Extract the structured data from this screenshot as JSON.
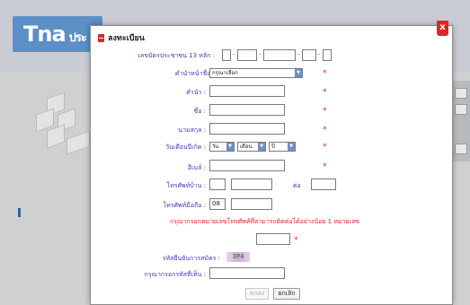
{
  "background": {
    "logo": "Tna",
    "logo_suffix": "ประ"
  },
  "modal": {
    "title": "ลงทะเบียน",
    "close_label": "x",
    "fields": {
      "id_label": "เลขบัตรประชาชน 13 หลัก :",
      "prefix_label": "คำนำหน้าชื่อ :",
      "prefix_value": "กรุณาเลือก",
      "name_label": "คำนำ :",
      "first_label": "ชื่อ :",
      "last_label": "นามสกุล :",
      "birth_label": "วันเดือนปีเกิด :",
      "birth_day": "วัน",
      "birth_month": "เดือน",
      "birth_year": "ปี",
      "email_label": "อีเมล์ :",
      "home_phone_label": "โทรศัพท์บ้าน :",
      "ext_label": "ต่อ",
      "mobile_label": "โทรศัพท์มือถือ :",
      "mobile_prefix": "08",
      "warning": "กรุณากรอกหมายเลขโทรศัพท์ที่สามารถติดต่อได้อย่างน้อย 1 หมายเลข",
      "captcha_label": "รหัสยืนยันการสมัคร :",
      "captcha_value": "3P4",
      "captcha_input_label": "กรุณากรอกรหัสที่เห็น :"
    },
    "buttons": {
      "submit": "ตกลง",
      "cancel": "ยกเลิก"
    }
  }
}
